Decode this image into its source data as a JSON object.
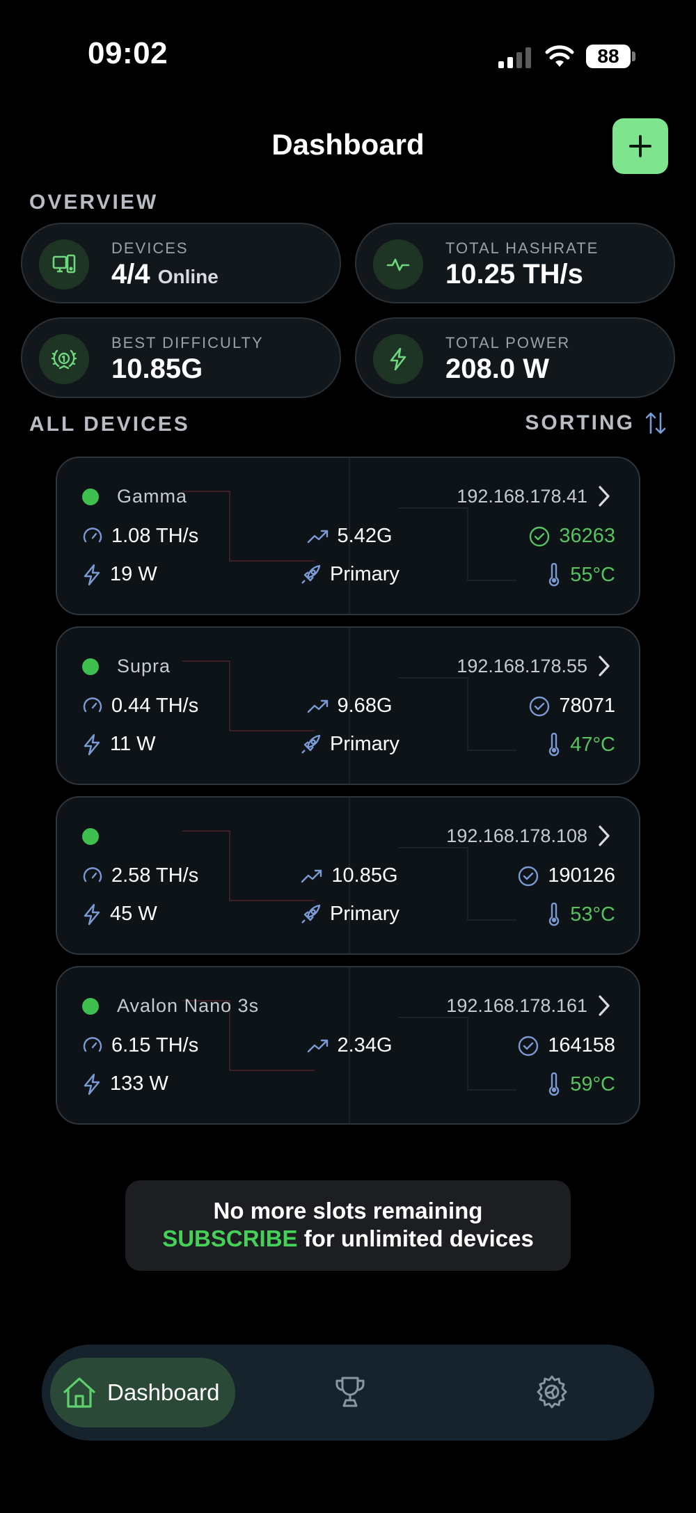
{
  "status_bar": {
    "time": "09:02",
    "battery": "88"
  },
  "header": {
    "title": "Dashboard"
  },
  "overview": {
    "section_label": "OVERVIEW",
    "cards": [
      {
        "label": "DEVICES",
        "value": "4/4",
        "suffix": "Online",
        "icon": "devices-icon"
      },
      {
        "label": "TOTAL HASHRATE",
        "value": "10.25 TH/s",
        "icon": "pulse-icon"
      },
      {
        "label": "BEST DIFFICULTY",
        "value": "10.85G",
        "icon": "laurel-badge-icon"
      },
      {
        "label": "TOTAL POWER",
        "value": "208.0 W",
        "icon": "bolt-icon"
      }
    ]
  },
  "devices_section": {
    "label": "ALL DEVICES",
    "sorting_label": "SORTING"
  },
  "devices": [
    {
      "name": "Gamma",
      "ip": "192.168.178.41",
      "hashrate": "1.08 TH/s",
      "difficulty": "5.42G",
      "shares": "36263",
      "shares_color": "#56c35e",
      "power": "19 W",
      "pool": "Primary",
      "temp": "55°C"
    },
    {
      "name": "Supra",
      "ip": "192.168.178.55",
      "hashrate": "0.44 TH/s",
      "difficulty": "9.68G",
      "shares": "78071",
      "shares_color": "#ffffff",
      "power": "11 W",
      "pool": "Primary",
      "temp": "47°C"
    },
    {
      "name": "",
      "ip": "192.168.178.108",
      "hashrate": "2.58 TH/s",
      "difficulty": "10.85G",
      "shares": "190126",
      "shares_color": "#ffffff",
      "power": "45 W",
      "pool": "Primary",
      "temp": "53°C"
    },
    {
      "name": "Avalon Nano 3s",
      "ip": "192.168.178.161",
      "hashrate": "6.15 TH/s",
      "difficulty": "2.34G",
      "shares": "164158",
      "shares_color": "#ffffff",
      "power": "133 W",
      "pool": "",
      "temp": "59°C"
    }
  ],
  "banner": {
    "line1": "No more slots remaining",
    "subscribe": "SUBSCRIBE",
    "line2_rest": " for unlimited devices"
  },
  "tabbar": {
    "tabs": [
      {
        "label": "Dashboard",
        "icon": "home-icon",
        "active": true
      },
      {
        "label": "",
        "icon": "trophy-icon",
        "active": false
      },
      {
        "label": "",
        "icon": "settings-icon",
        "active": false
      }
    ]
  },
  "colors": {
    "accent": "#7fe48e",
    "online": "#3fbf4f",
    "temp": "#56c35e",
    "icon_blue": "#7b9bd6"
  }
}
